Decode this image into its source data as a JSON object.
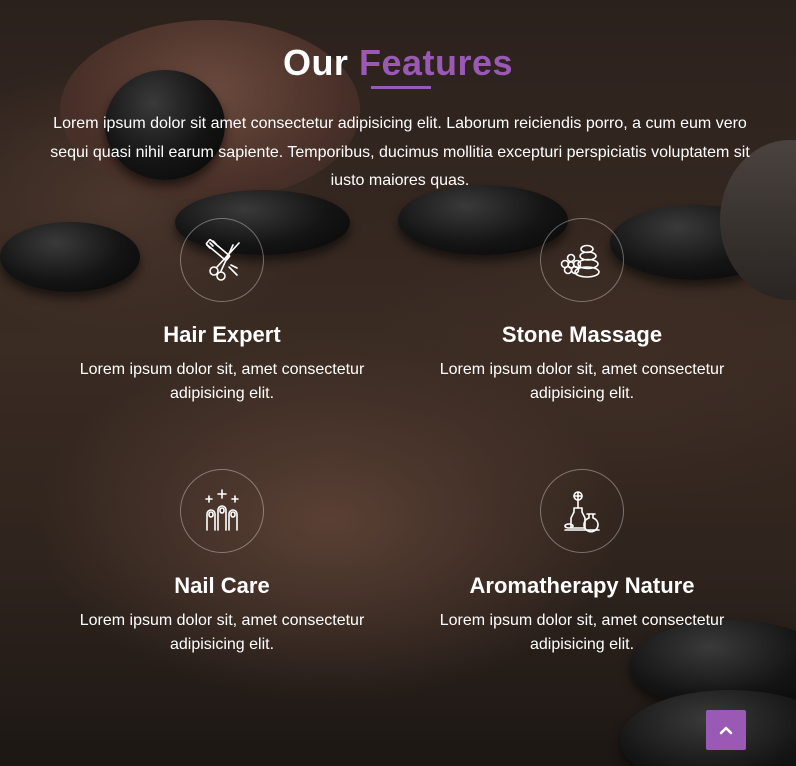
{
  "section": {
    "title_part1": "Our",
    "title_part2": "Features",
    "intro": "Lorem ipsum dolor sit amet consectetur adipisicing elit. Laborum reiciendis porro, a cum eum vero sequi quasi nihil earum sapiente. Temporibus, ducimus mollitia excepturi perspiciatis voluptatem sit iusto maiores quas."
  },
  "features": [
    {
      "title": "Hair Expert",
      "description": "Lorem ipsum dolor sit, amet consectetur adipisicing elit.",
      "icon": "scissors-comb-icon"
    },
    {
      "title": "Stone Massage",
      "description": "Lorem ipsum dolor sit, amet consectetur adipisicing elit.",
      "icon": "stones-flower-icon"
    },
    {
      "title": "Nail Care",
      "description": "Lorem ipsum dolor sit, amet consectetur adipisicing elit.",
      "icon": "nails-sparkle-icon"
    },
    {
      "title": "Aromatherapy Nature",
      "description": "Lorem ipsum dolor sit, amet consectetur adipisicing elit.",
      "icon": "aroma-bottles-icon"
    }
  ],
  "colors": {
    "accent": "#9b59b6",
    "text": "#ffffff"
  },
  "scroll_top": {
    "icon": "chevron-up-icon"
  }
}
